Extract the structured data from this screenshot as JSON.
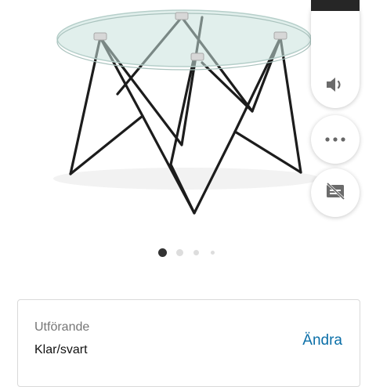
{
  "gallery": {
    "image_alt": "Glass top coffee table with black hairpin legs",
    "dot_count": 4,
    "active_dot": 0
  },
  "controls": {
    "sound_icon": "volume-icon",
    "more_icon": "more-horizontal-icon",
    "captions_icon": "captions-off-icon"
  },
  "variant": {
    "title": "Utförande",
    "value": "Klar/svart",
    "change_label": "Ändra"
  },
  "colors": {
    "accent_link": "#0b6fa8",
    "dot_active": "#333333",
    "dot_inactive": "#dddddd"
  }
}
